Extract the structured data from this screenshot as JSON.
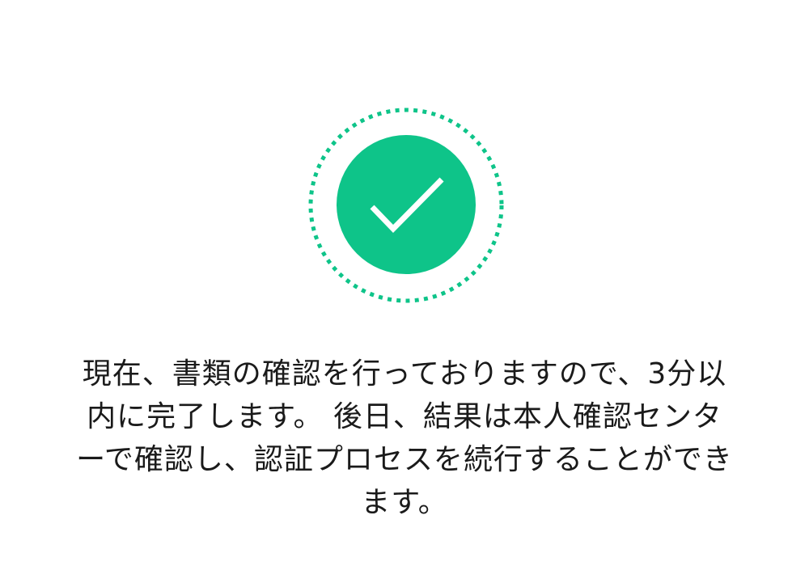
{
  "status": {
    "icon": "check-circle-icon",
    "accent_color": "#0ec489",
    "check_color": "#ffffff"
  },
  "message": {
    "lines": [
      "現在、書類の確認を行っておりますので、3分以",
      "内に完了します。 後日、結果は本人確認センタ",
      "ーで確認し、認証プロセスを続行することができ",
      "ます。"
    ]
  }
}
